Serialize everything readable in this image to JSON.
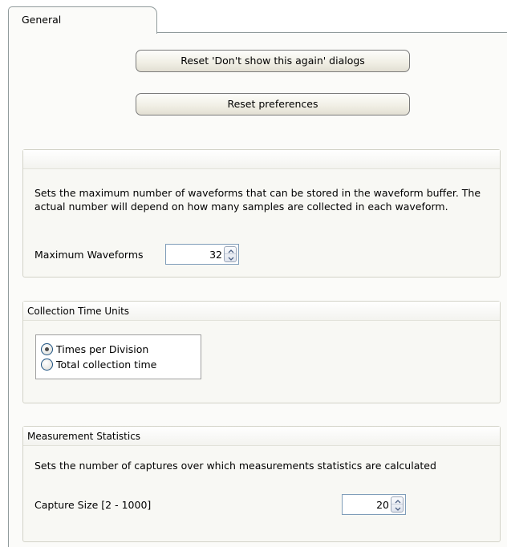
{
  "tabs": [
    {
      "label": "General"
    }
  ],
  "buttons": {
    "reset_dialogs": "Reset 'Don't show this again' dialogs",
    "reset_preferences": "Reset preferences"
  },
  "waveforms": {
    "header": "",
    "description": "Sets the maximum number of waveforms that can be stored in the waveform buffer. The actual number will depend on how many samples are collected in each waveform.",
    "label": "Maximum Waveforms",
    "value": "32"
  },
  "collection_time_units": {
    "header": "Collection Time Units",
    "options": [
      {
        "label": "Times per Division",
        "selected": true
      },
      {
        "label": "Total collection time",
        "selected": false
      }
    ]
  },
  "measurement_statistics": {
    "header": "Measurement Statistics",
    "description": "Sets the number of captures over which measurements statistics are calculated",
    "label": "Capture Size [2 - 1000]",
    "value": "20"
  }
}
